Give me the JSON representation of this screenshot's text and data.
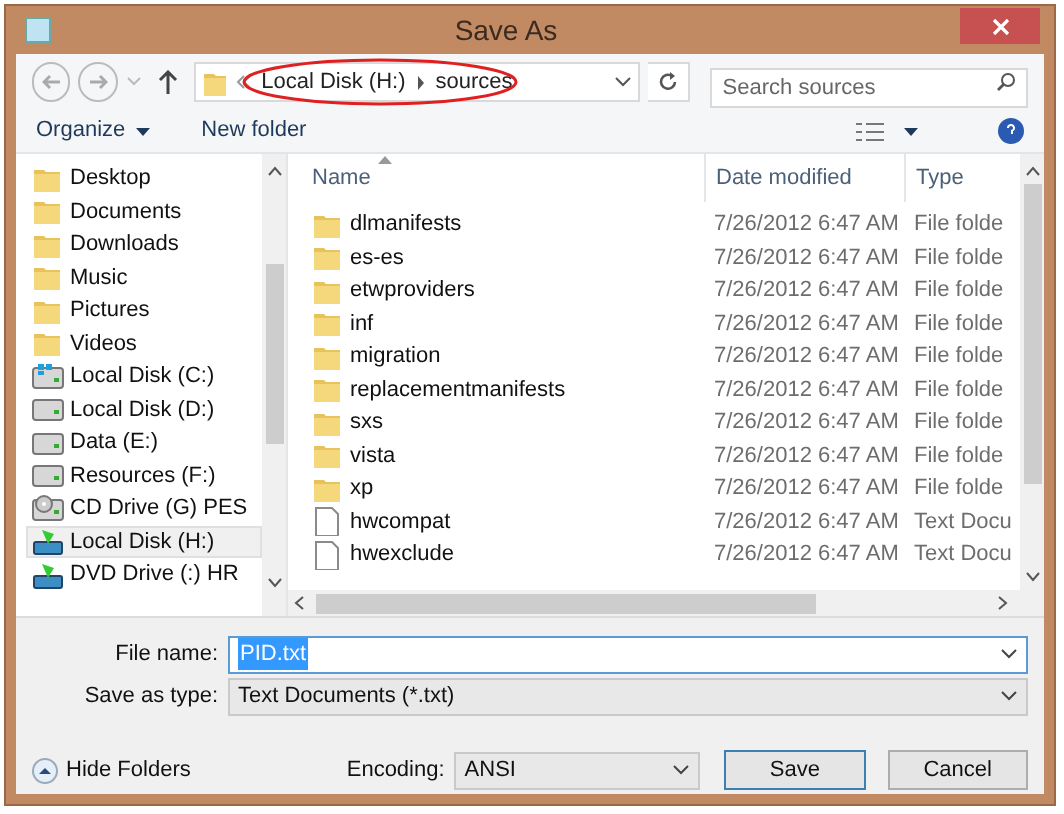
{
  "window": {
    "title": "Save As"
  },
  "address_bar": {
    "breadcrumbs": [
      "Local Disk (H:)",
      "sources"
    ],
    "highlighted": true
  },
  "search": {
    "placeholder": "Search sources"
  },
  "command_bar": {
    "buttons": [
      "Organize",
      "New folder"
    ]
  },
  "sidebar": {
    "items": [
      {
        "label": "Desktop",
        "kind": "folder",
        "selected": false
      },
      {
        "label": "Documents",
        "kind": "folder",
        "selected": false
      },
      {
        "label": "Downloads",
        "kind": "folder",
        "selected": false
      },
      {
        "label": "Music",
        "kind": "folder",
        "selected": false
      },
      {
        "label": "Pictures",
        "kind": "folder",
        "selected": false
      },
      {
        "label": "Videos",
        "kind": "folder",
        "selected": false
      },
      {
        "label": "Local Disk (C:)",
        "kind": "system-drive",
        "selected": false
      },
      {
        "label": "Local Disk (D:)",
        "kind": "drive",
        "selected": false
      },
      {
        "label": "Data (E:)",
        "kind": "drive",
        "selected": false
      },
      {
        "label": "Resources (F:)",
        "kind": "drive",
        "selected": false
      },
      {
        "label": "CD Drive (G) PES",
        "kind": "cd-drive",
        "selected": false
      },
      {
        "label": "Local Disk (H:)",
        "kind": "image-drive",
        "selected": true
      },
      {
        "label": "DVD Drive (:) HR",
        "kind": "image-drive",
        "selected": false
      }
    ]
  },
  "file_list": {
    "columns": [
      {
        "label": "Name",
        "sorted": true
      },
      {
        "label": "Date modified",
        "sorted": false
      },
      {
        "label": "Type",
        "sorted": false
      }
    ],
    "rows": [
      {
        "name": "dlmanifests",
        "kind": "folder",
        "date": "7/26/2012 6:47 AM",
        "type": "File folde"
      },
      {
        "name": "es-es",
        "kind": "folder",
        "date": "7/26/2012 6:47 AM",
        "type": "File folde"
      },
      {
        "name": "etwproviders",
        "kind": "folder",
        "date": "7/26/2012 6:47 AM",
        "type": "File folde"
      },
      {
        "name": "inf",
        "kind": "folder",
        "date": "7/26/2012 6:47 AM",
        "type": "File folde"
      },
      {
        "name": "migration",
        "kind": "folder",
        "date": "7/26/2012 6:47 AM",
        "type": "File folde"
      },
      {
        "name": "replacementmanifests",
        "kind": "folder",
        "date": "7/26/2012 6:47 AM",
        "type": "File folde"
      },
      {
        "name": "sxs",
        "kind": "folder",
        "date": "7/26/2012 6:47 AM",
        "type": "File folde"
      },
      {
        "name": "vista",
        "kind": "folder",
        "date": "7/26/2012 6:47 AM",
        "type": "File folde"
      },
      {
        "name": "xp",
        "kind": "folder",
        "date": "7/26/2012 6:47 AM",
        "type": "File folde"
      },
      {
        "name": "hwcompat",
        "kind": "text",
        "date": "7/26/2012 6:47 AM",
        "type": "Text Docu"
      },
      {
        "name": "hwexclude",
        "kind": "text",
        "date": "7/26/2012 6:47 AM",
        "type": "Text Docu"
      }
    ]
  },
  "form": {
    "file_name_label": "File name:",
    "file_name": "PID.txt",
    "type_label": "Save as type:",
    "type_value": "Text Documents (*.txt)"
  },
  "footer": {
    "hide_folders": "Hide Folders",
    "encoding_label": "Encoding:",
    "encoding": "ANSI",
    "buttons": [
      "Save",
      "Cancel"
    ]
  }
}
